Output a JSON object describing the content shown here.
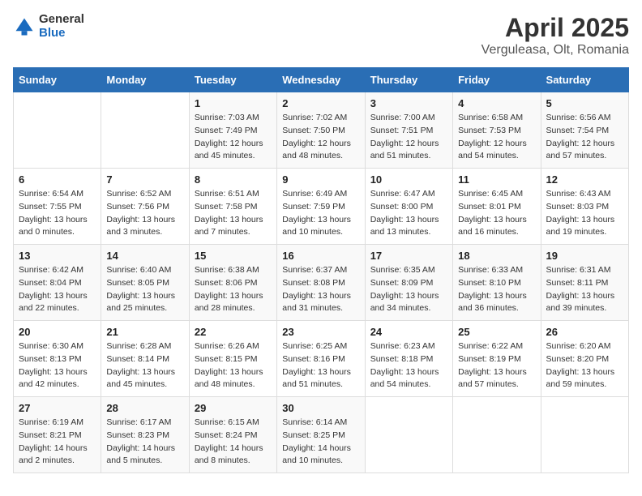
{
  "logo": {
    "general": "General",
    "blue": "Blue"
  },
  "title": "April 2025",
  "subtitle": "Verguleasa, Olt, Romania",
  "weekdays": [
    "Sunday",
    "Monday",
    "Tuesday",
    "Wednesday",
    "Thursday",
    "Friday",
    "Saturday"
  ],
  "weeks": [
    [
      {
        "day": "",
        "info": ""
      },
      {
        "day": "",
        "info": ""
      },
      {
        "day": "1",
        "info": "Sunrise: 7:03 AM\nSunset: 7:49 PM\nDaylight: 12 hours and 45 minutes."
      },
      {
        "day": "2",
        "info": "Sunrise: 7:02 AM\nSunset: 7:50 PM\nDaylight: 12 hours and 48 minutes."
      },
      {
        "day": "3",
        "info": "Sunrise: 7:00 AM\nSunset: 7:51 PM\nDaylight: 12 hours and 51 minutes."
      },
      {
        "day": "4",
        "info": "Sunrise: 6:58 AM\nSunset: 7:53 PM\nDaylight: 12 hours and 54 minutes."
      },
      {
        "day": "5",
        "info": "Sunrise: 6:56 AM\nSunset: 7:54 PM\nDaylight: 12 hours and 57 minutes."
      }
    ],
    [
      {
        "day": "6",
        "info": "Sunrise: 6:54 AM\nSunset: 7:55 PM\nDaylight: 13 hours and 0 minutes."
      },
      {
        "day": "7",
        "info": "Sunrise: 6:52 AM\nSunset: 7:56 PM\nDaylight: 13 hours and 3 minutes."
      },
      {
        "day": "8",
        "info": "Sunrise: 6:51 AM\nSunset: 7:58 PM\nDaylight: 13 hours and 7 minutes."
      },
      {
        "day": "9",
        "info": "Sunrise: 6:49 AM\nSunset: 7:59 PM\nDaylight: 13 hours and 10 minutes."
      },
      {
        "day": "10",
        "info": "Sunrise: 6:47 AM\nSunset: 8:00 PM\nDaylight: 13 hours and 13 minutes."
      },
      {
        "day": "11",
        "info": "Sunrise: 6:45 AM\nSunset: 8:01 PM\nDaylight: 13 hours and 16 minutes."
      },
      {
        "day": "12",
        "info": "Sunrise: 6:43 AM\nSunset: 8:03 PM\nDaylight: 13 hours and 19 minutes."
      }
    ],
    [
      {
        "day": "13",
        "info": "Sunrise: 6:42 AM\nSunset: 8:04 PM\nDaylight: 13 hours and 22 minutes."
      },
      {
        "day": "14",
        "info": "Sunrise: 6:40 AM\nSunset: 8:05 PM\nDaylight: 13 hours and 25 minutes."
      },
      {
        "day": "15",
        "info": "Sunrise: 6:38 AM\nSunset: 8:06 PM\nDaylight: 13 hours and 28 minutes."
      },
      {
        "day": "16",
        "info": "Sunrise: 6:37 AM\nSunset: 8:08 PM\nDaylight: 13 hours and 31 minutes."
      },
      {
        "day": "17",
        "info": "Sunrise: 6:35 AM\nSunset: 8:09 PM\nDaylight: 13 hours and 34 minutes."
      },
      {
        "day": "18",
        "info": "Sunrise: 6:33 AM\nSunset: 8:10 PM\nDaylight: 13 hours and 36 minutes."
      },
      {
        "day": "19",
        "info": "Sunrise: 6:31 AM\nSunset: 8:11 PM\nDaylight: 13 hours and 39 minutes."
      }
    ],
    [
      {
        "day": "20",
        "info": "Sunrise: 6:30 AM\nSunset: 8:13 PM\nDaylight: 13 hours and 42 minutes."
      },
      {
        "day": "21",
        "info": "Sunrise: 6:28 AM\nSunset: 8:14 PM\nDaylight: 13 hours and 45 minutes."
      },
      {
        "day": "22",
        "info": "Sunrise: 6:26 AM\nSunset: 8:15 PM\nDaylight: 13 hours and 48 minutes."
      },
      {
        "day": "23",
        "info": "Sunrise: 6:25 AM\nSunset: 8:16 PM\nDaylight: 13 hours and 51 minutes."
      },
      {
        "day": "24",
        "info": "Sunrise: 6:23 AM\nSunset: 8:18 PM\nDaylight: 13 hours and 54 minutes."
      },
      {
        "day": "25",
        "info": "Sunrise: 6:22 AM\nSunset: 8:19 PM\nDaylight: 13 hours and 57 minutes."
      },
      {
        "day": "26",
        "info": "Sunrise: 6:20 AM\nSunset: 8:20 PM\nDaylight: 13 hours and 59 minutes."
      }
    ],
    [
      {
        "day": "27",
        "info": "Sunrise: 6:19 AM\nSunset: 8:21 PM\nDaylight: 14 hours and 2 minutes."
      },
      {
        "day": "28",
        "info": "Sunrise: 6:17 AM\nSunset: 8:23 PM\nDaylight: 14 hours and 5 minutes."
      },
      {
        "day": "29",
        "info": "Sunrise: 6:15 AM\nSunset: 8:24 PM\nDaylight: 14 hours and 8 minutes."
      },
      {
        "day": "30",
        "info": "Sunrise: 6:14 AM\nSunset: 8:25 PM\nDaylight: 14 hours and 10 minutes."
      },
      {
        "day": "",
        "info": ""
      },
      {
        "day": "",
        "info": ""
      },
      {
        "day": "",
        "info": ""
      }
    ]
  ]
}
